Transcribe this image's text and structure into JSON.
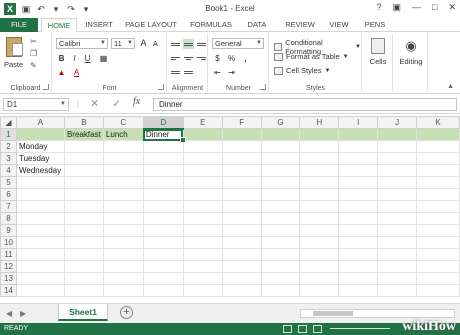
{
  "window": {
    "title": "Book1 - Excel"
  },
  "tabs": [
    "FILE",
    "HOME",
    "INSERT",
    "PAGE LAYOUT",
    "FORMULAS",
    "DATA",
    "REVIEW",
    "VIEW",
    "PENS"
  ],
  "ribbon": {
    "clipboard": {
      "paste": "Paste",
      "label": "Clipboard"
    },
    "font": {
      "name": "Calibri",
      "size": "11",
      "bold": "B",
      "italic": "I",
      "underline": "U",
      "grow": "A",
      "shrink": "A",
      "font_color": "A",
      "label": "Font"
    },
    "alignment": {
      "label": "Alignment"
    },
    "number": {
      "format": "General",
      "currency": "$",
      "percent": "%",
      "comma": ",",
      "label": "Number"
    },
    "styles": {
      "conditional": "Conditional Formatting",
      "format_table": "Format as Table",
      "cell_styles": "Cell Styles",
      "label": "Styles"
    },
    "cells": {
      "label": "Cells"
    },
    "editing": {
      "label": "Editing"
    }
  },
  "formula_bar": {
    "name_box": "D1",
    "fx": "fx",
    "value": "Dinner"
  },
  "columns": [
    "A",
    "B",
    "C",
    "D",
    "E",
    "F",
    "G",
    "H",
    "I",
    "J",
    "K"
  ],
  "rows": [
    {
      "num": "1",
      "cells": [
        "",
        "Breakfast",
        "Lunch",
        "Dinner",
        "",
        "",
        "",
        "",
        "",
        "",
        ""
      ]
    },
    {
      "num": "2",
      "cells": [
        "Monday",
        "",
        "",
        "",
        "",
        "",
        "",
        "",
        "",
        "",
        ""
      ]
    },
    {
      "num": "3",
      "cells": [
        "Tuesday",
        "",
        "",
        "",
        "",
        "",
        "",
        "",
        "",
        "",
        ""
      ]
    },
    {
      "num": "4",
      "cells": [
        "Wednesday",
        "",
        "",
        "",
        "",
        "",
        "",
        "",
        "",
        "",
        ""
      ]
    },
    {
      "num": "5",
      "cells": [
        "",
        "",
        "",
        "",
        "",
        "",
        "",
        "",
        "",
        "",
        ""
      ]
    },
    {
      "num": "6",
      "cells": [
        "",
        "",
        "",
        "",
        "",
        "",
        "",
        "",
        "",
        "",
        ""
      ]
    },
    {
      "num": "7",
      "cells": [
        "",
        "",
        "",
        "",
        "",
        "",
        "",
        "",
        "",
        "",
        ""
      ]
    },
    {
      "num": "8",
      "cells": [
        "",
        "",
        "",
        "",
        "",
        "",
        "",
        "",
        "",
        "",
        ""
      ]
    },
    {
      "num": "9",
      "cells": [
        "",
        "",
        "",
        "",
        "",
        "",
        "",
        "",
        "",
        "",
        ""
      ]
    },
    {
      "num": "10",
      "cells": [
        "",
        "",
        "",
        "",
        "",
        "",
        "",
        "",
        "",
        "",
        ""
      ]
    },
    {
      "num": "11",
      "cells": [
        "",
        "",
        "",
        "",
        "",
        "",
        "",
        "",
        "",
        "",
        ""
      ]
    },
    {
      "num": "12",
      "cells": [
        "",
        "",
        "",
        "",
        "",
        "",
        "",
        "",
        "",
        "",
        ""
      ]
    },
    {
      "num": "13",
      "cells": [
        "",
        "",
        "",
        "",
        "",
        "",
        "",
        "",
        "",
        "",
        ""
      ]
    },
    {
      "num": "14",
      "cells": [
        "",
        "",
        "",
        "",
        "",
        "",
        "",
        "",
        "",
        "",
        ""
      ]
    }
  ],
  "sheet_tabs": {
    "active": "Sheet1",
    "add": "+"
  },
  "status": {
    "text": "READY"
  },
  "watermark": "wikiHow",
  "colors": {
    "accent": "#217346",
    "highlight_row": "#c6e0b4"
  }
}
